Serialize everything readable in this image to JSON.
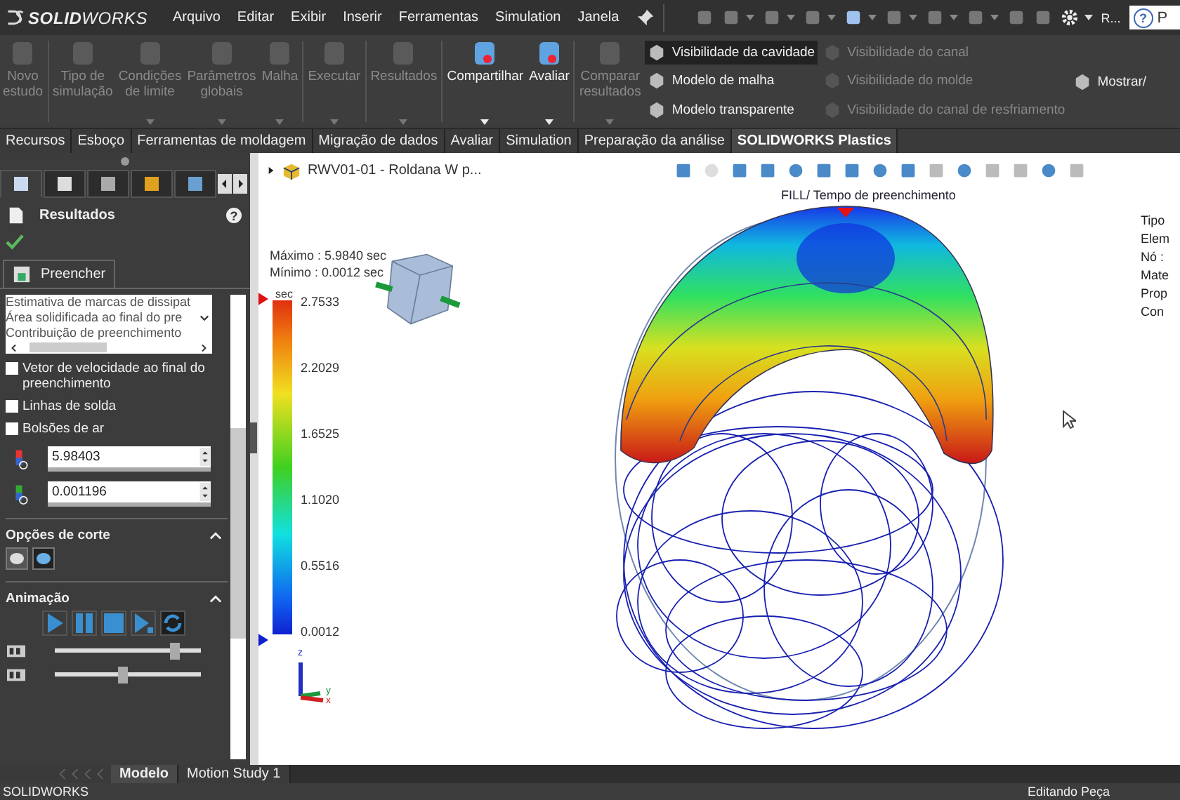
{
  "title_bar": {
    "logo": "**SOLID**WORKS",
    "menu": [
      "Arquivo",
      "Editar",
      "Exibir",
      "Inserir",
      "Ferramentas",
      "Simulation",
      "Janela"
    ],
    "more": "R...",
    "help": "?",
    "search_text": "P"
  },
  "ribbon": {
    "buttons": [
      {
        "label": "Novo\nestudo",
        "disabled": true,
        "dropdown": false,
        "separator_before": false
      },
      {
        "label": "Tipo de\nsimulação",
        "disabled": true,
        "dropdown": false,
        "separator_before": true
      },
      {
        "label": "Condições\nde limite",
        "disabled": true,
        "dropdown": true,
        "separator_before": false
      },
      {
        "label": "Parâmetros\nglobais",
        "disabled": true,
        "dropdown": true,
        "separator_before": false
      },
      {
        "label": "Malha",
        "disabled": true,
        "dropdown": true,
        "separator_before": false
      },
      {
        "label": "Executar",
        "disabled": true,
        "dropdown": true,
        "separator_before": true
      },
      {
        "label": "Resultados",
        "disabled": true,
        "dropdown": true,
        "separator_before": true
      },
      {
        "label": "Compartilhar",
        "disabled": false,
        "dropdown": true,
        "separator_before": true
      },
      {
        "label": "Avaliar",
        "disabled": false,
        "dropdown": true,
        "separator_before": false
      },
      {
        "label": "Comparar\nresultados",
        "disabled": true,
        "dropdown": true,
        "separator_before": true
      }
    ],
    "view_columns": [
      [
        {
          "label": "Visibilidade da cavidade",
          "disabled": false,
          "selected": true
        },
        {
          "label": "Modelo de malha",
          "disabled": false,
          "selected": false
        },
        {
          "label": "Modelo transparente",
          "disabled": false,
          "selected": false
        }
      ],
      [
        {
          "label": "Visibilidade do canal",
          "disabled": true,
          "selected": false
        },
        {
          "label": "Visibilidade do molde",
          "disabled": true,
          "selected": false
        },
        {
          "label": "Visibilidade do canal de resfriamento",
          "disabled": true,
          "selected": false
        }
      ],
      [
        {
          "label": "Mostrar/",
          "disabled": false,
          "selected": false
        }
      ]
    ]
  },
  "tabs": [
    {
      "label": "Recursos",
      "selected": false
    },
    {
      "label": "Esboço",
      "selected": false
    },
    {
      "label": "Ferramentas de moldagem",
      "selected": false
    },
    {
      "label": "Migração de dados",
      "selected": false
    },
    {
      "label": "Avaliar",
      "selected": false
    },
    {
      "label": "Simulation",
      "selected": false
    },
    {
      "label": "Preparação da análise",
      "selected": false
    },
    {
      "label": "SOLIDWORKS Plastics",
      "selected": true
    }
  ],
  "panel": {
    "icon_tabs": [
      {
        "selected": true
      },
      {
        "selected": false
      },
      {
        "selected": false
      },
      {
        "selected": false
      },
      {
        "selected": false
      }
    ],
    "title": "Resultados",
    "help": "?",
    "section_tab": "Preencher",
    "result_list": [
      "Estimativa de marcas de dissipat",
      "Área solidificada ao final do pre",
      "Contribuição de preenchimento"
    ],
    "options": [
      {
        "label": "Vetor de velocidade ao final do preenchimento",
        "checked": false
      },
      {
        "label": "Linhas de solda",
        "checked": false
      },
      {
        "label": "Bolsões de ar",
        "checked": false
      }
    ],
    "range": [
      {
        "value": "5.98403"
      },
      {
        "value": "0.001196"
      }
    ],
    "cut_options": {
      "title": "Opções de corte",
      "expanded": true,
      "buttons": [
        {
          "selected": false
        },
        {
          "selected": true
        }
      ]
    },
    "animation": {
      "title": "Animação",
      "expanded": true,
      "controls": [
        {
          "kind": "play",
          "selected": false
        },
        {
          "kind": "pause",
          "selected": false
        },
        {
          "kind": "stop",
          "selected": false
        },
        {
          "kind": "step",
          "selected": false
        },
        {
          "kind": "loop",
          "selected": true
        }
      ],
      "sliders": [
        {
          "level": 0.82
        },
        {
          "level": 0.46
        }
      ]
    }
  },
  "viewport": {
    "document": "RWV01-01 - Roldana W p...",
    "plot_title": "FILL/ Tempo de preenchimento",
    "maximum": "Máximo : 5.9840 sec",
    "minimum": "Mínimo : 0.0012 sec",
    "legend": {
      "unit": "sec",
      "ticks": [
        "2.7533",
        "2.2029",
        "1.6525",
        "1.1020",
        "0.5516",
        "0.0012"
      ]
    },
    "triad": [
      "z",
      "y",
      "x"
    ],
    "info": [
      "Tipo",
      "Elem",
      "Nó :",
      "Mate",
      "Prop",
      "Con"
    ]
  },
  "bottom_tabs": [
    {
      "label": "Modelo",
      "selected": true
    },
    {
      "label": "Motion Study 1",
      "selected": false
    }
  ],
  "status_bar": [
    "SOLIDWORKS",
    "Editando Peça"
  ]
}
